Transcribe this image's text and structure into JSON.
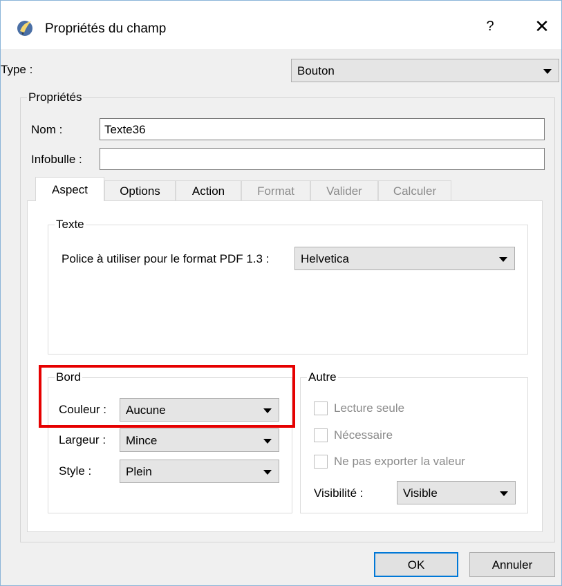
{
  "window": {
    "title": "Propriétés du champ",
    "help": "?",
    "close": "✕"
  },
  "type_row": {
    "label": "Type :",
    "value": "Bouton"
  },
  "proprietes": {
    "legend": "Propriétés",
    "nom_label": "Nom :",
    "nom_value": "Texte36",
    "infobulle_label": "Infobulle :",
    "infobulle_value": ""
  },
  "tabs": [
    {
      "label": "Aspect",
      "state": "active"
    },
    {
      "label": "Options",
      "state": "enabled"
    },
    {
      "label": "Action",
      "state": "enabled"
    },
    {
      "label": "Format",
      "state": "disabled"
    },
    {
      "label": "Valider",
      "state": "disabled"
    },
    {
      "label": "Calculer",
      "state": "disabled"
    }
  ],
  "texte": {
    "legend": "Texte",
    "police_label": "Police à utiliser pour le format PDF 1.3 :",
    "police_value": "Helvetica"
  },
  "bord": {
    "legend": "Bord",
    "couleur_label": "Couleur :",
    "couleur_value": "Aucune",
    "largeur_label": "Largeur :",
    "largeur_value": "Mince",
    "style_label": "Style :",
    "style_value": "Plein"
  },
  "autre": {
    "legend": "Autre",
    "lecture_seule": "Lecture seule",
    "necessaire": "Nécessaire",
    "ne_pas_exporter": "Ne pas exporter la valeur",
    "visibilite_label": "Visibilité :",
    "visibilite_value": "Visible"
  },
  "buttons": {
    "ok": "OK",
    "annuler": "Annuler"
  },
  "colors": {
    "highlight": "#e60000",
    "focus": "#0078d7"
  }
}
